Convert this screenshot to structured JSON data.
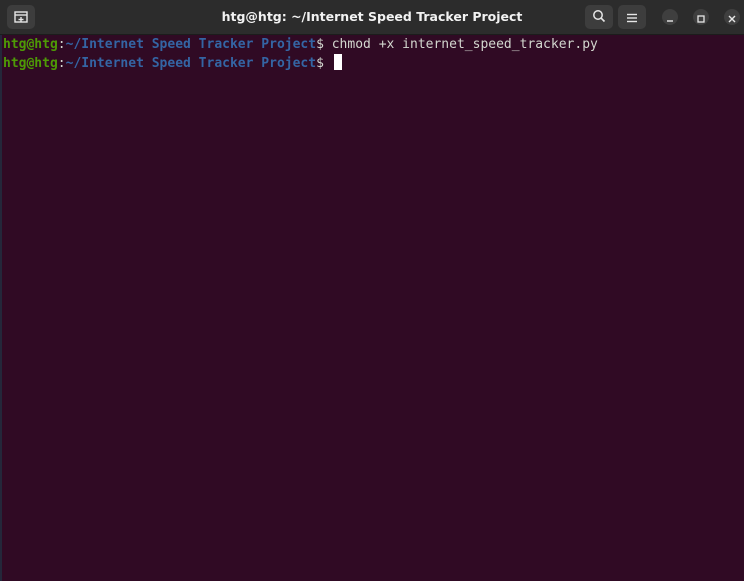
{
  "window": {
    "title": "htg@htg: ~/Internet Speed Tracker Project"
  },
  "header": {
    "new_tab_icon": "terminal-tab-icon",
    "search_icon": "search-icon",
    "menu_icon": "hamburger-menu-icon",
    "minimize_icon": "minimize-icon",
    "maximize_icon": "maximize-icon",
    "close_icon": "close-icon"
  },
  "terminal": {
    "lines": [
      {
        "user_host": "htg@htg",
        "colon": ":",
        "path": "~/Internet Speed Tracker Project",
        "dollar": "$ ",
        "command": "chmod +x internet_speed_tracker.py"
      },
      {
        "user_host": "htg@htg",
        "colon": ":",
        "path": "~/Internet Speed Tracker Project",
        "dollar": "$ ",
        "command": ""
      }
    ]
  },
  "colors": {
    "terminal_bg": "#300a24",
    "user_host": "#4e9a06",
    "path": "#3465a4",
    "text": "#d3d7cf",
    "titlebar_bg": "#2c2c2c"
  }
}
